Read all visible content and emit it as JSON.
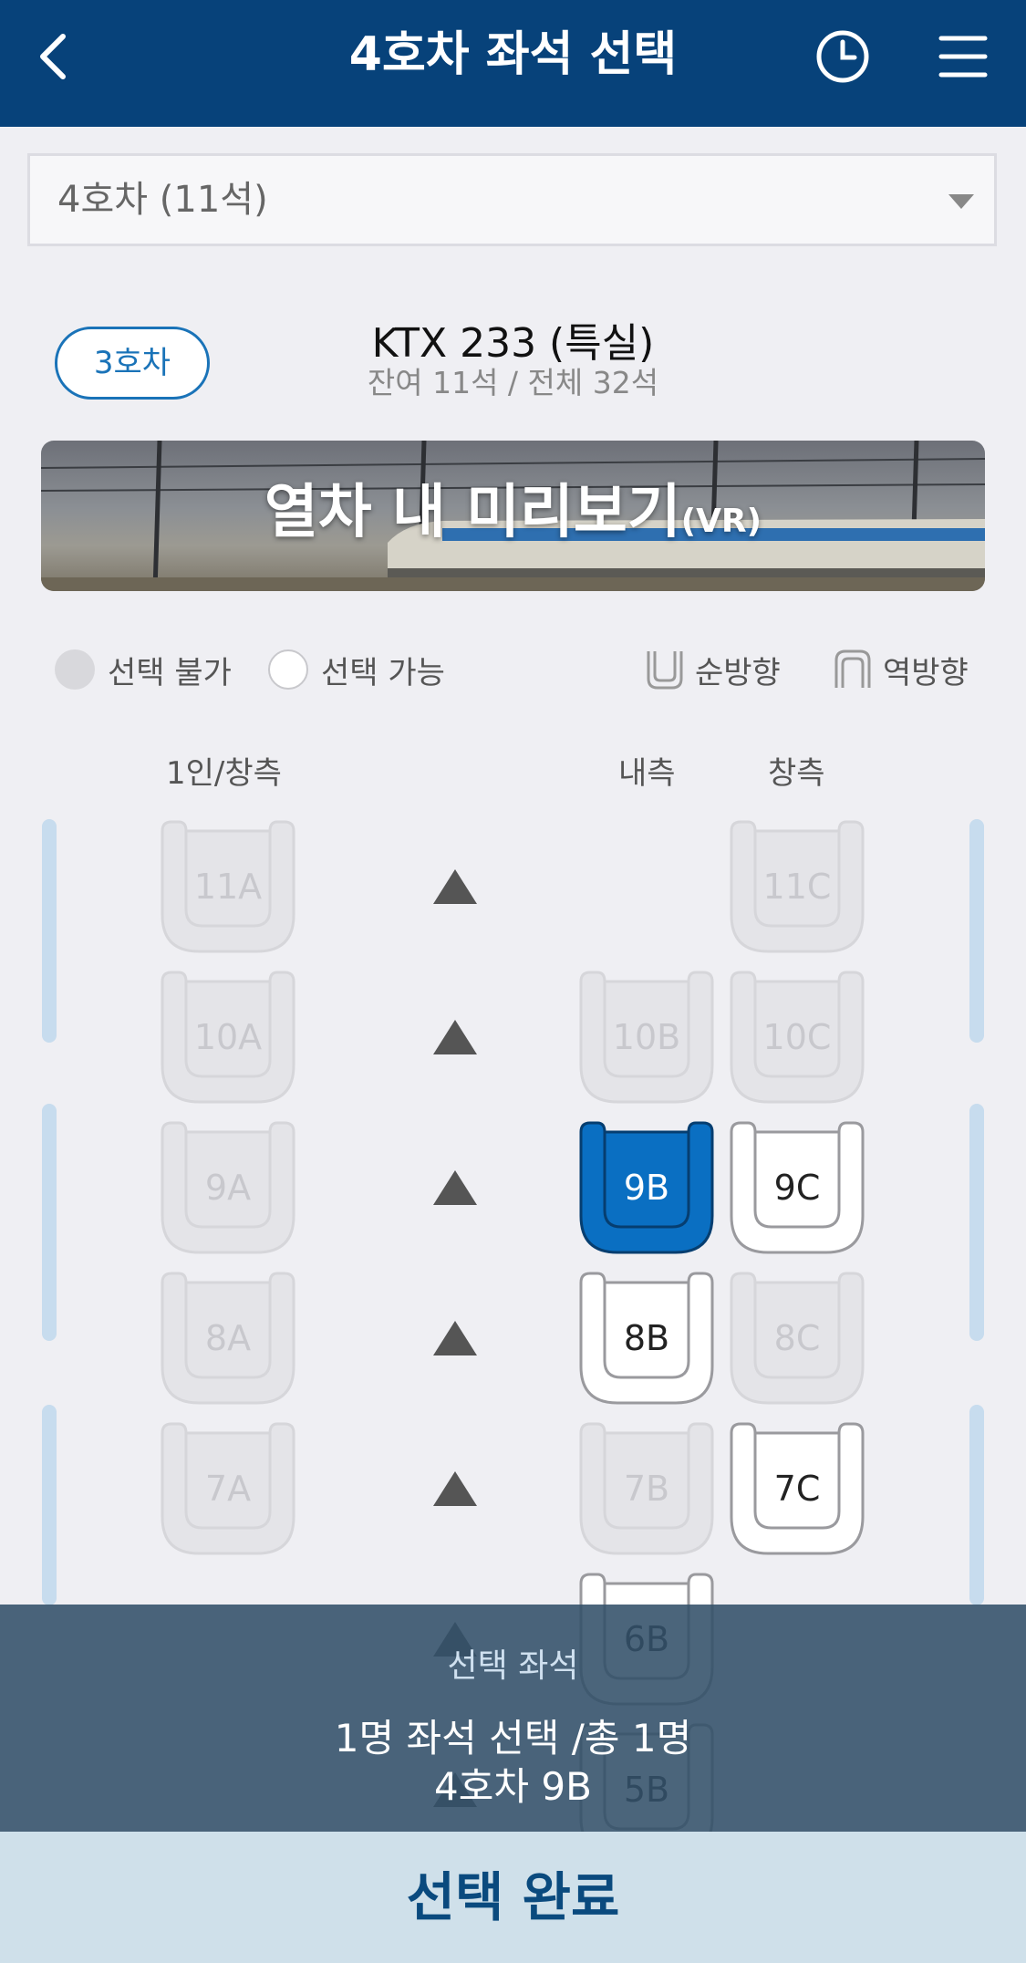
{
  "header": {
    "title": "4호차 좌석 선택",
    "back_icon": "back-chevron-icon",
    "history_icon": "clock-icon",
    "menu_icon": "hamburger-menu-icon"
  },
  "car_select": {
    "value": "4호차 (11석)"
  },
  "prev_car_label": "3호차",
  "train": {
    "name": "KTX 233 (특실)",
    "seats_summary": "잔여 11석 / 전체 32석"
  },
  "vr_banner": {
    "title": "열차 내 미리보기",
    "suffix": "(VR)"
  },
  "legend": {
    "unavailable": "선택 불가",
    "available": "선택 가능",
    "forward": "순방향",
    "backward": "역방향"
  },
  "columns": {
    "single_window": "1인/창측",
    "aisle": "내측",
    "window": "창측"
  },
  "seats": {
    "r11": [
      "11A",
      "",
      "11C"
    ],
    "r10": [
      "10A",
      "10B",
      "10C"
    ],
    "r9": [
      "9A",
      "9B",
      "9C"
    ],
    "r8": [
      "8A",
      "8B",
      "8C"
    ],
    "r7": [
      "7A",
      "7B",
      "7C"
    ],
    "r6": [
      "",
      "6B",
      ""
    ],
    "r5": [
      "",
      "5B",
      ""
    ]
  },
  "seat_states": {
    "11A": "unavailable",
    "11C": "unavailable",
    "10A": "unavailable",
    "10B": "unavailable",
    "10C": "unavailable",
    "9A": "unavailable",
    "9B": "selected",
    "9C": "available",
    "8A": "unavailable",
    "8B": "available",
    "8C": "unavailable",
    "7A": "unavailable",
    "7B": "unavailable",
    "7C": "available",
    "6B": "available",
    "5B": "available"
  },
  "colors": {
    "header": "#07427a",
    "selected_seat": "#0a6fc2",
    "done_button_bg": "#cfe0ea"
  },
  "selection": {
    "label": "선택 좌석",
    "count_text": "1명 좌석 선택 /총 1명",
    "seat_text": "4호차 9B"
  },
  "done_button": "선택 완료"
}
